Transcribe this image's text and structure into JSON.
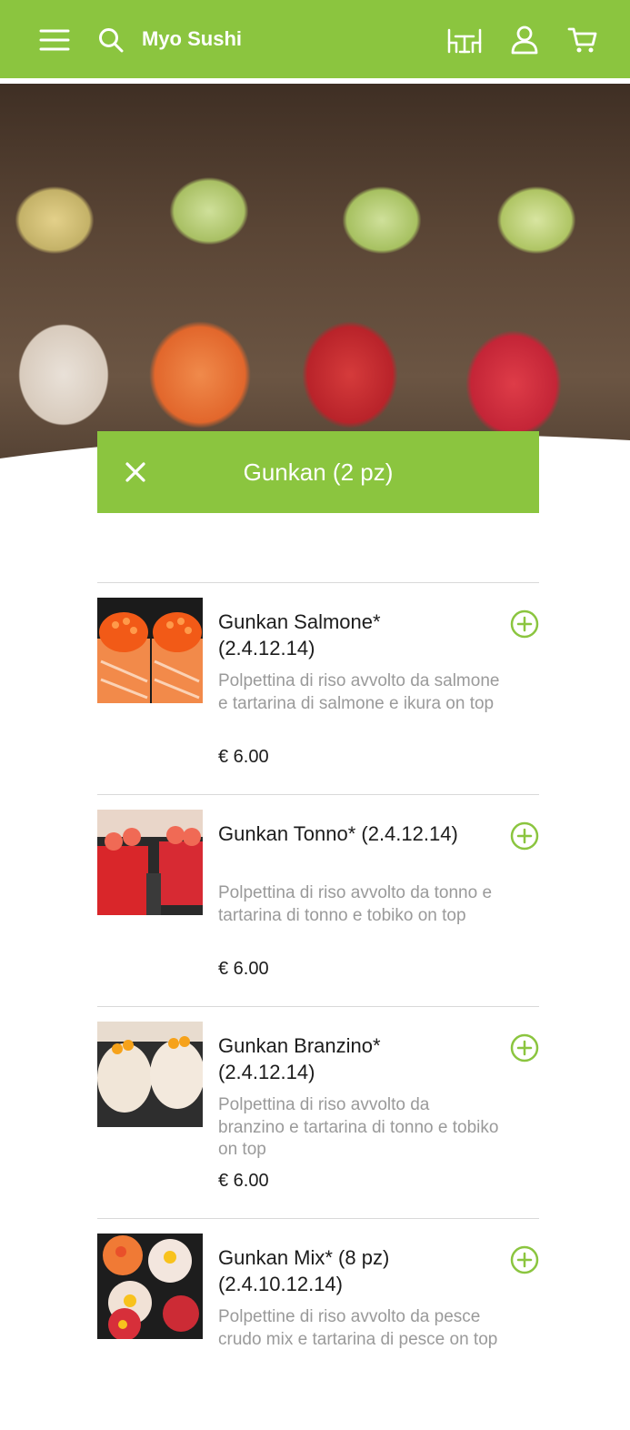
{
  "header": {
    "brand": "Myo Sushi",
    "icons": [
      "menu-icon",
      "search-icon",
      "table-icon",
      "user-icon",
      "cart-icon"
    ],
    "accent_color": "#8bc53f"
  },
  "category": {
    "title": "Gunkan (2 pz)"
  },
  "items": [
    {
      "name": "Gunkan Salmone* (2.4.12.14)",
      "description": "Polpettina di riso avvolto da salmone e tartarina di salmone e ikura on top",
      "price": "€ 6.00",
      "image": "gunkan-salmone"
    },
    {
      "name": "Gunkan Tonno* (2.4.12.14)",
      "description": "Polpettina di riso avvolto da tonno e tartarina di tonno e tobiko on top",
      "price": "€ 6.00",
      "image": "gunkan-tonno"
    },
    {
      "name": "Gunkan Branzino* (2.4.12.14)",
      "description": "Polpettina di riso avvolto da branzino e tartarina di tonno e tobiko on top",
      "price": "€ 6.00",
      "image": "gunkan-branzino"
    },
    {
      "name": "Gunkan Mix* (8 pz) (2.4.10.12.14)",
      "description": "Polpettine di riso avvolto da pesce crudo mix e tartarina di pesce on top",
      "price": "",
      "image": "gunkan-mix"
    }
  ]
}
